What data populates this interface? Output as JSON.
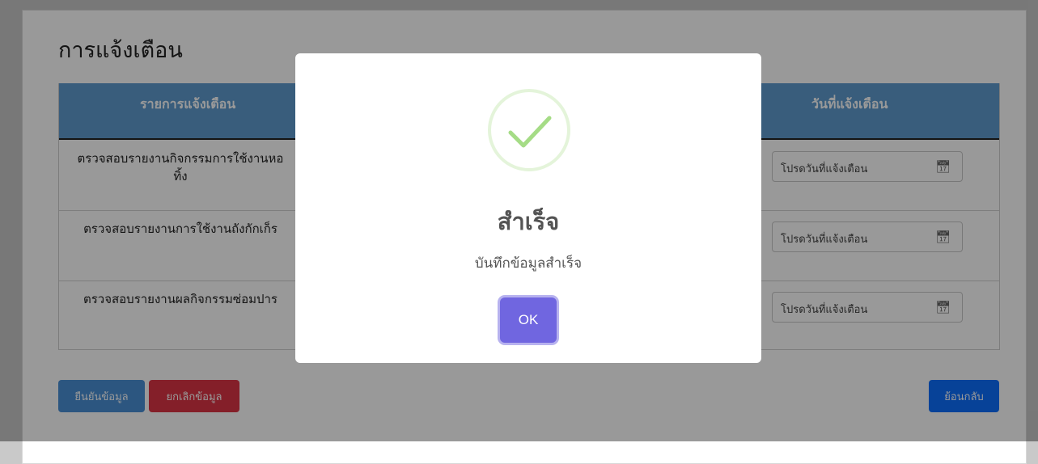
{
  "page": {
    "title": "การแจ้งเตือน"
  },
  "table": {
    "headers": {
      "item": "รายการแจ้งเตือน",
      "date": "วันที่แจ้งเตือน"
    },
    "rows": [
      {
        "item": "ตรวจสอบรายงานกิจกรรมการใช้งานหอ\nทิ้ง",
        "date_placeholder": "โปรดวันที่แจ้งเตือน"
      },
      {
        "item": "ตรวจสอบรายงานการใช้งานถังกักเก็ร",
        "date_placeholder": "โปรดวันที่แจ้งเตือน"
      },
      {
        "item": "ตรวจสอบรายงานผลกิจกรรมซ่อมปาร",
        "date_placeholder": "โปรดวันที่แจ้งเตือน"
      }
    ]
  },
  "buttons": {
    "confirm": "ยืนยันข้อมูล",
    "cancel": "ยกเลิกข้อมูล",
    "back": "ย้อนกลับ"
  },
  "modal": {
    "title": "สำเร็จ",
    "message": "บันทึกข้อมูลสำเร็จ",
    "ok_label": "OK",
    "icon": "success-check-icon"
  },
  "colors": {
    "table_header": "#5f9ccf",
    "confirm_button": "#4a8fd6",
    "cancel_button": "#dc3545",
    "back_button": "#0d6efd",
    "ok_button": "#7066e0",
    "success_check": "#a5dc86"
  }
}
